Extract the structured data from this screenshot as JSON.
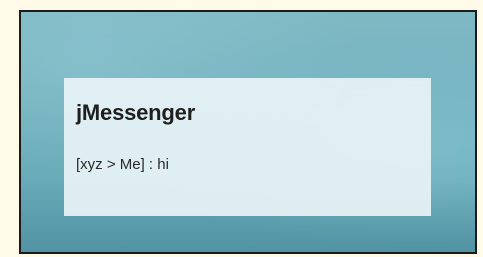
{
  "notification": {
    "title": "jMessenger",
    "message": "[xyz > Me] : hi"
  },
  "colors": {
    "background": "#6eaebb",
    "panel": "#e8f3f6",
    "border": "#1b1b1b",
    "text": "#1f1f1f"
  }
}
